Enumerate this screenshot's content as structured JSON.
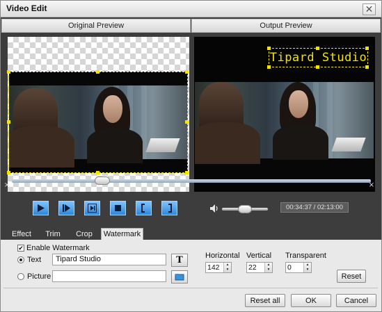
{
  "window": {
    "title": "Video Edit",
    "close_glyph": "✕"
  },
  "headers": {
    "original": "Original Preview",
    "output": "Output Preview"
  },
  "watermark_preview": "Tipard  Studio",
  "playback": {
    "time": "00:34:37 / 02:13:00",
    "timeline_position": 0.24,
    "volume_level": 0.5
  },
  "controls": [
    {
      "name": "play-button",
      "icon": "play-icon"
    },
    {
      "name": "step-forward-button",
      "icon": "step-forward-icon"
    },
    {
      "name": "next-frame-button",
      "icon": "next-frame-icon"
    },
    {
      "name": "stop-button",
      "icon": "stop-icon"
    },
    {
      "name": "set-start-button",
      "icon": "left-bracket-icon"
    },
    {
      "name": "set-end-button",
      "icon": "right-bracket-icon"
    }
  ],
  "tabs": [
    {
      "label": "Effect",
      "active": false
    },
    {
      "label": "Trim",
      "active": false
    },
    {
      "label": "Crop",
      "active": false
    },
    {
      "label": "Watermark",
      "active": true
    }
  ],
  "watermark": {
    "enable_label": "Enable Watermark",
    "enabled": true,
    "text_option_label": "Text",
    "text_value": "Tipard  Studio",
    "picture_option_label": "Picture",
    "picture_value": "",
    "text_selected": true,
    "horizontal_label": "Horizontal",
    "horizontal_value": "142",
    "vertical_label": "Vertical",
    "vertical_value": "22",
    "transparent_label": "Transparent",
    "transparent_value": "0",
    "reset_label": "Reset"
  },
  "footer": {
    "reset_all_label": "Reset all",
    "ok_label": "OK",
    "cancel_label": "Cancel"
  },
  "colors": {
    "accent_blue": "#2f86d9",
    "watermark_yellow": "#f2e400",
    "dark_panel": "#3d3d3d"
  }
}
